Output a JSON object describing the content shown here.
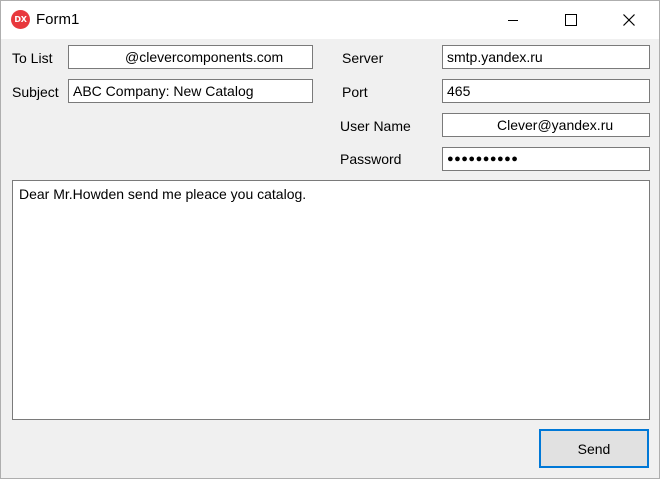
{
  "window": {
    "title": "Form1",
    "app_icon_text": "DX"
  },
  "form": {
    "to_list": {
      "label": "To List",
      "value": "@clevercomponents.com"
    },
    "subject": {
      "label": "Subject",
      "value": "ABC Company: New Catalog"
    },
    "server": {
      "label": "Server",
      "value": "smtp.yandex.ru"
    },
    "port": {
      "label": "Port",
      "value": "465"
    },
    "user_name": {
      "label": "User Name",
      "value": "Clever@yandex.ru"
    },
    "password": {
      "label": "Password",
      "value": "●●●●●●●●●●"
    },
    "body_text": "Dear Mr.Howden send me pleace you catalog."
  },
  "actions": {
    "send_label": "Send"
  },
  "colors": {
    "accent": "#0078d7",
    "icon_red": "#e8383d",
    "window_bg": "#f0f0f0"
  }
}
